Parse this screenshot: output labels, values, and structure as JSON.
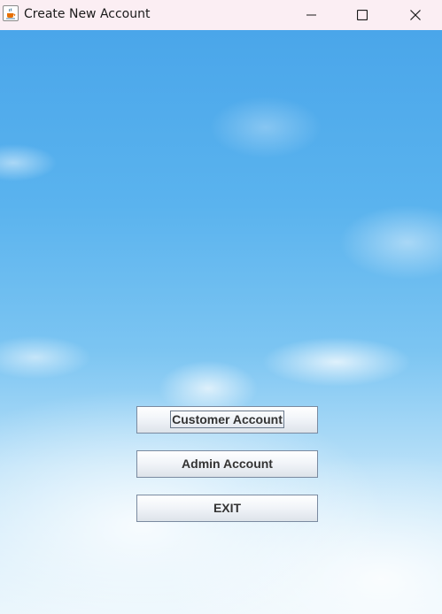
{
  "window": {
    "title": "Create New Account",
    "app_icon": "java-cup-icon",
    "controls": [
      "minimize-icon",
      "maximize-icon",
      "close-icon"
    ]
  },
  "buttons": {
    "customer_account": "Customer Account",
    "admin_account": "Admin Account",
    "exit": "EXIT"
  },
  "focused_button": "customer_account",
  "colors": {
    "titlebar_bg": "#fbeef3",
    "sky_top": "#4aa6ea",
    "sky_bottom": "#e8f5fc",
    "button_text": "#333333",
    "button_border": "#7a8aa0"
  }
}
